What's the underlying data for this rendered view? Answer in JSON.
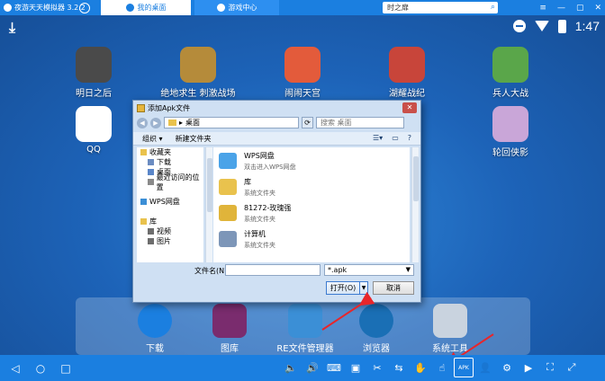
{
  "window": {
    "title": "夜游天天模拟器 3.2.2"
  },
  "tabs": [
    {
      "label": "我的桌面"
    },
    {
      "label": "游戏中心"
    }
  ],
  "search": {
    "value": "时之扉"
  },
  "window_controls": [
    "≡",
    "—",
    "▢",
    "✕"
  ],
  "status": {
    "time": "1:47"
  },
  "desktop_apps": [
    {
      "label": "明日之后",
      "color": "#4a4a4a"
    },
    {
      "label": "绝地求生 刺激战场",
      "color": "#b58b3a"
    },
    {
      "label": "闹闹天宫",
      "color": "#e35b3b"
    },
    {
      "label": "湖耀战纪",
      "color": "#c8453a"
    },
    {
      "label": "兵人大战",
      "color": "#5aa64a"
    },
    {
      "label": "QQ",
      "color": "#ffffff"
    },
    {
      "label": "轮回侠影",
      "color": "#c9a6d8"
    }
  ],
  "dock": [
    {
      "label": "下载",
      "color": "#1b7fe0"
    },
    {
      "label": "图库",
      "color": "#7a2c6e"
    },
    {
      "label": "RE文件管理器",
      "color": "#3b8fd6"
    },
    {
      "label": "浏览器",
      "color": "#1a6fb5"
    },
    {
      "label": "系统工具",
      "color": "#c9d3df"
    }
  ],
  "dialog": {
    "title": "添加Apk文件",
    "address": "桌面",
    "address_sep": "▸",
    "search_placeholder": "搜索 桌面",
    "organize": "组织 ▾",
    "new_folder": "新建文件夹",
    "nav": [
      {
        "label": "收藏夹",
        "type": "head",
        "color": "#e9c24d"
      },
      {
        "label": "下载",
        "type": "sub",
        "color": "#6b8cc1"
      },
      {
        "label": "桌面",
        "type": "sub",
        "color": "#5a86c9"
      },
      {
        "label": "最近访问的位置",
        "type": "sub",
        "color": "#8a8a8a"
      },
      {
        "label": "",
        "type": "gap",
        "color": "transparent"
      },
      {
        "label": "WPS网盘",
        "type": "head",
        "color": "#3b8fd6"
      },
      {
        "label": "",
        "type": "gap",
        "color": "transparent"
      },
      {
        "label": "库",
        "type": "head",
        "color": "#e9c24d"
      },
      {
        "label": "视频",
        "type": "sub",
        "color": "#6d6d6d"
      },
      {
        "label": "图片",
        "type": "sub",
        "color": "#6d6d6d"
      }
    ],
    "files": [
      {
        "name": "WPS网盘",
        "desc": "双击进入WPS网盘",
        "color": "#4aa3e8"
      },
      {
        "name": "库",
        "desc": "系统文件夹",
        "color": "#e9c24d"
      },
      {
        "name": "81272-玫瑰强",
        "desc": "系统文件夹",
        "color": "#e0b43a"
      },
      {
        "name": "计算机",
        "desc": "系统文件夹",
        "color": "#7d96b8"
      }
    ],
    "filename_label": "文件名(N):",
    "filename_value": "",
    "filetype": "*.apk",
    "open": "打开(O)",
    "cancel": "取消"
  },
  "bottom_nav": [
    "◁",
    "○",
    "□"
  ],
  "tool_buttons": [
    "🔈",
    "🔊",
    "⌨",
    "▣",
    "✂",
    "⇆",
    "✋",
    "☝",
    "APK",
    "👤",
    "⚙",
    "▶",
    "⛶",
    "⤢"
  ]
}
